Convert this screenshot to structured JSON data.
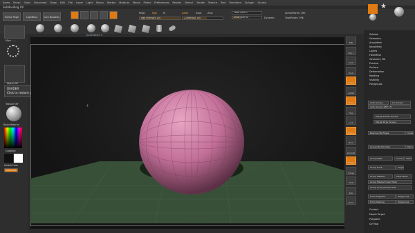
{
  "menu": [
    "Alpha",
    "Brush",
    "Color",
    "Document",
    "Draw",
    "Edit",
    "File",
    "Layer",
    "Light",
    "Macro",
    "Marker",
    "Material",
    "Movie",
    "Picker",
    "Preferences",
    "Render",
    "Stencil",
    "Stroke",
    "Texture",
    "Tool",
    "Transform",
    "Zplugin",
    "Zscript"
  ],
  "subtitle": "Subdividing UV",
  "toolbar": {
    "home_page": "Home Page",
    "lightbox": "LightBox",
    "live_boolean": "Live Boolean",
    "mrgb": "Mrgb",
    "rgb": "Rgb",
    "m": "M",
    "zadd": "Zadd",
    "zsub": "Zsub",
    "zcut": "Zcut",
    "rgb_intensity": "Rgb Intensity 100",
    "z_intensity": "Z Intensity 100",
    "focal_shift": "Focal Shift 0",
    "draw_size": "Draw Size 64",
    "dynamic": "Dynamic",
    "active_points": "ActivePoints: 39K",
    "total_points": "TotalPoints: 39K",
    "quicksketch": "QuickSketch 4"
  },
  "left": {
    "view_label": "Vibe: .....",
    "alpha_off": "Alpha Off",
    "texture_off": "Texture Off",
    "material": "BasicMaterial",
    "gradient": "Gradient",
    "switch_color": "SwitchColor",
    "alternate": "Alternate"
  },
  "tooltip": {
    "title": "DIVIDER",
    "body": "Click to restore previous position."
  },
  "right_shelf": [
    "BPR",
    "SPix 3",
    "Scroll",
    "Zoom",
    "Actual",
    "AAHalf",
    "Persp",
    "Floor",
    "Local",
    "Frame",
    "Move",
    "Zoom3D",
    "Rotate",
    "Transp",
    "Ghost",
    "Solo",
    "Xpose"
  ],
  "tool_thumbs": [
    "PM3D_PolySphe",
    "SimpleBrush",
    "PolyMesh3D",
    "PM3D_PolySphe"
  ],
  "panel": {
    "items": [
      "Subtool",
      "Geometry",
      "ArrayMesh",
      "NanoMesh",
      "Layers",
      "FiberMesh",
      "Geometry HD",
      "Preview",
      "Surface",
      "Deformation",
      "Masking",
      "Visibility",
      "Polygroups"
    ],
    "buttons": [
      "Auto Groups",
      "Uv Groups",
      "Auto Groups With UV",
      "Merge Similar Groups",
      "Merge Stray Groups",
      "Regroup By Edges",
      "Coverage",
      "Groups By Normals",
      "Max Angle Tol",
      "GroupsSplit",
      "Coverage",
      "Clear Ar",
      "Group Front",
      "Angle",
      "Group Masked",
      "Clear Mask",
      "Group Masked Clear Mask",
      "Group As Dynamesh Sub",
      "From Polypaint",
      "Polygroups",
      "From Masking",
      "Polygroups"
    ],
    "bottom_items": [
      "Contact",
      "Morph Target",
      "Polypaint",
      "UV Map"
    ]
  },
  "viewport": {
    "sphere_color": "#c87aa0",
    "floor_color": "#3e5a3e"
  }
}
